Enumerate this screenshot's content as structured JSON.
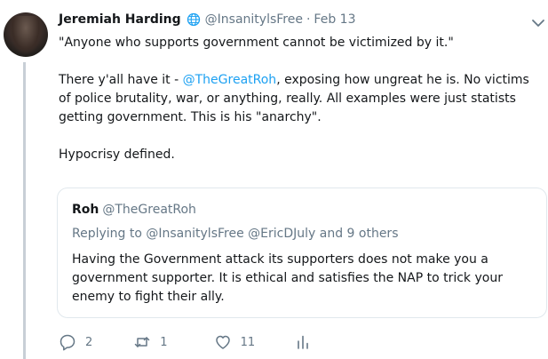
{
  "colors": {
    "accent": "#1da1f2",
    "secondary_text": "#657786",
    "primary_text": "#14171a",
    "border": "#e1e8ed",
    "thread_line": "#c8cfd6"
  },
  "tweet": {
    "author_name": "Jeremiah Harding",
    "verified_icon": "globe-icon",
    "handle": "@InsanitylsFree",
    "separator": "·",
    "date": "Feb 13",
    "menu_icon": "chevron-down-icon",
    "line1": "\"Anyone who supports government cannot be victimized by it.\"",
    "para2_prefix": "There y'all have it - ",
    "para2_mention": "@TheGreatRoh",
    "para2_rest": ", exposing how ungreat he is. No victims of police brutality, war, or anything, really. All examples were just statists getting government. This is his \"anarchy\".",
    "line3": "Hypocrisy defined."
  },
  "quoted_tweet": {
    "author_name": "Roh",
    "handle": "@TheGreatRoh",
    "replying_prefix": "Replying to ",
    "replying_users": "@InsanitylsFree @EricDJuly",
    "replying_suffix": " and 9 others",
    "text": "Having the Government attack its supporters does not make you a government supporter.   It is ethical and satisfies the NAP to trick your enemy to fight their ally."
  },
  "actions": {
    "reply": {
      "icon": "reply-icon",
      "count": "2"
    },
    "retweet": {
      "icon": "retweet-icon",
      "count": "1"
    },
    "like": {
      "icon": "heart-icon",
      "count": "11"
    },
    "analytics": {
      "icon": "analytics-icon"
    }
  }
}
